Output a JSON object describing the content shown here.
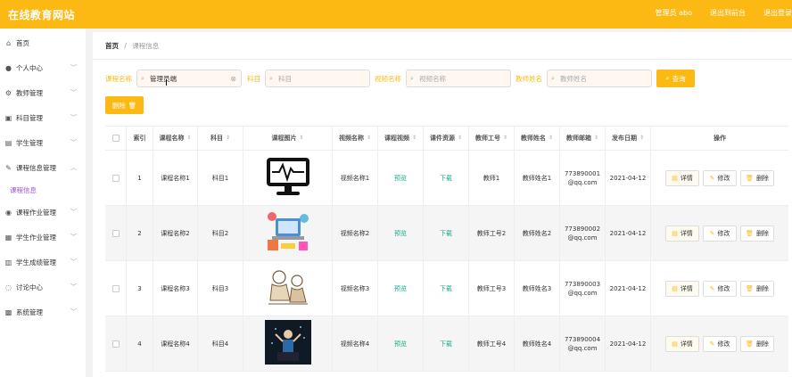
{
  "header": {
    "brand": "在线教育网站",
    "nav": [
      "管理员 abo",
      "退出到前台",
      "退出登录"
    ]
  },
  "sidebar": {
    "items": [
      {
        "label": "首页",
        "icon": "home-icon",
        "glyph": "⌂",
        "arrow": false
      },
      {
        "label": "个人中心",
        "icon": "user-icon",
        "glyph": "●",
        "arrow": true
      },
      {
        "label": "教师管理",
        "icon": "teacher-icon",
        "glyph": "⚙",
        "arrow": true
      },
      {
        "label": "科目管理",
        "icon": "subject-icon",
        "glyph": "▣",
        "arrow": true
      },
      {
        "label": "学生管理",
        "icon": "student-icon",
        "glyph": "▤",
        "arrow": true
      },
      {
        "label": "课程信息管理",
        "icon": "course-icon",
        "glyph": "✎",
        "arrow": true,
        "expanded": true,
        "sub": "课程信息"
      },
      {
        "label": "课程作业管理",
        "icon": "homework-icon",
        "glyph": "◉",
        "arrow": true
      },
      {
        "label": "学生作业管理",
        "icon": "student-homework-icon",
        "glyph": "▦",
        "arrow": true
      },
      {
        "label": "学生成绩管理",
        "icon": "grade-icon",
        "glyph": "▥",
        "arrow": true
      },
      {
        "label": "讨论中心",
        "icon": "discussion-icon",
        "glyph": "◌",
        "arrow": true
      },
      {
        "label": "系统管理",
        "icon": "system-icon",
        "glyph": "▩",
        "arrow": true
      }
    ]
  },
  "breadcrumb": {
    "home": "首页",
    "sep": "/",
    "current": "课程信息"
  },
  "search": {
    "course_label": "课程名称",
    "course_value": "管理员端",
    "subject_label": "科目",
    "subject_placeholder": "科目",
    "video_label": "视频名称",
    "video_placeholder": "视频名称",
    "teacher_label": "教师姓名",
    "teacher_placeholder": "教师姓名",
    "query_button": "查询",
    "delete_button": "删除"
  },
  "table": {
    "headers": [
      "索引",
      "课程名称",
      "科目",
      "课程图片",
      "视频名称",
      "课程视频",
      "课件资源",
      "教师工号",
      "教师姓名",
      "教师邮箱",
      "发布日期",
      "操作"
    ],
    "rows": [
      {
        "index": "1",
        "course": "课程名称1",
        "subject": "科目1",
        "video": "视频名称1",
        "preview": "预览",
        "download": "下载",
        "teacher_no": "教师1",
        "teacher_name": "教师姓名1",
        "email1": "773890001",
        "email2": "@qq.com",
        "date": "2021-04-12",
        "img": "monitor"
      },
      {
        "index": "2",
        "course": "课程名称2",
        "subject": "科目2",
        "video": "视频名称2",
        "preview": "预览",
        "download": "下载",
        "teacher_no": "教师工号2",
        "teacher_name": "教师姓名2",
        "email1": "773890002",
        "email2": "@qq.com",
        "date": "2021-04-12",
        "img": "laptop"
      },
      {
        "index": "3",
        "course": "课程名称3",
        "subject": "科目3",
        "video": "视频名称3",
        "preview": "预览",
        "download": "下载",
        "teacher_no": "教师工号3",
        "teacher_name": "教师姓名3",
        "email1": "773890003",
        "email2": "@qq.com",
        "date": "2021-04-12",
        "img": "sketch"
      },
      {
        "index": "4",
        "course": "课程名称4",
        "subject": "科目4",
        "video": "视频名称4",
        "preview": "预览",
        "download": "下载",
        "teacher_no": "教师工号4",
        "teacher_name": "教师姓名4",
        "email1": "773890004",
        "email2": "@qq.com",
        "date": "2021-04-12",
        "img": "dark"
      }
    ],
    "actions": {
      "detail": "详情",
      "edit": "修改",
      "delete": "删除"
    }
  },
  "colors": {
    "accent": "#fdb913",
    "link": "#19a98b",
    "submenu": "#9b5ad1"
  }
}
